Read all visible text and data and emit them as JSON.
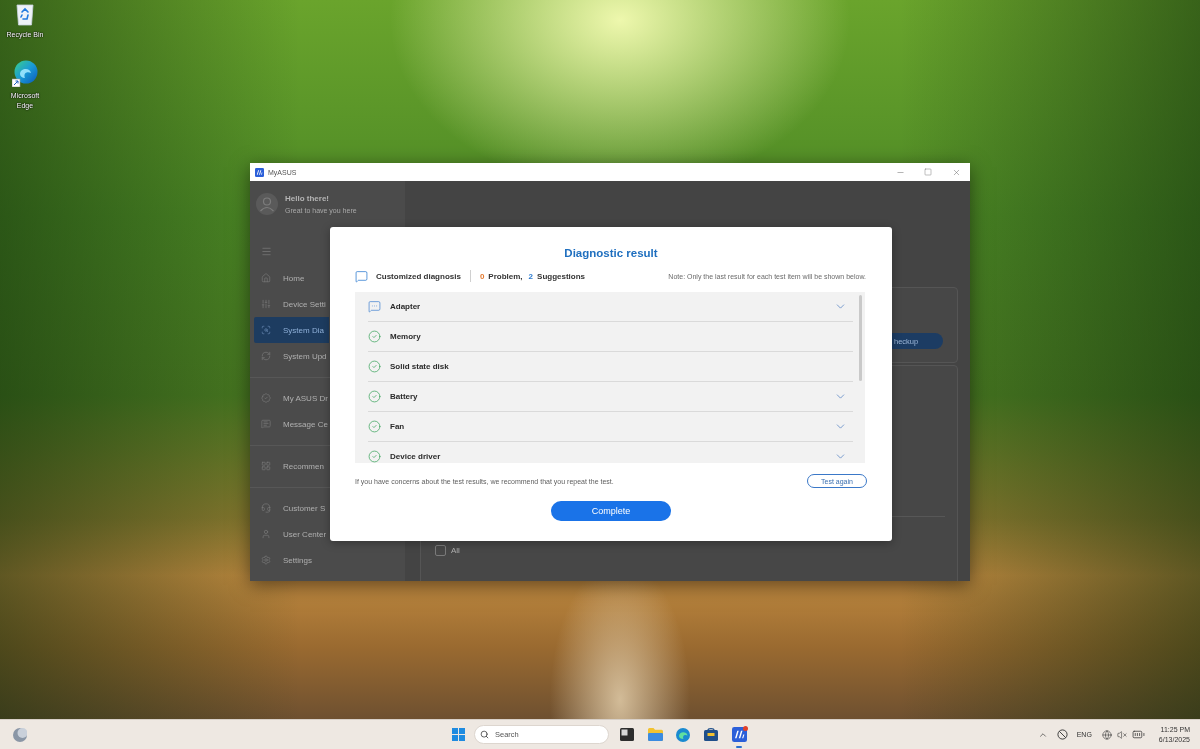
{
  "desktop_icons": [
    {
      "label": "Recycle Bin",
      "kind": "recycle-bin"
    },
    {
      "label": "Microsoft Edge",
      "kind": "edge"
    }
  ],
  "window": {
    "title": "MyASUS",
    "sidebar": {
      "greeting": "Hello there!",
      "subtitle": "Great to have you here",
      "groups": [
        {
          "items": [
            {
              "label": "Home",
              "kind": "home",
              "selected": false
            },
            {
              "label": "Device Setti",
              "kind": "device-settings",
              "selected": false
            },
            {
              "label": "System Dia",
              "kind": "system-diagnosis",
              "selected": true
            },
            {
              "label": "System Upd",
              "kind": "system-update",
              "selected": false
            }
          ]
        },
        {
          "items": [
            {
              "label": "My ASUS Dr",
              "kind": "deals",
              "selected": false
            },
            {
              "label": "Message Ce",
              "kind": "messages",
              "selected": false
            }
          ]
        },
        {
          "items": [
            {
              "label": "Recommen",
              "kind": "recommend",
              "selected": false
            }
          ]
        },
        {
          "items": [
            {
              "label": "Customer S",
              "kind": "support",
              "selected": false
            },
            {
              "label": "User Center",
              "kind": "user",
              "selected": false
            },
            {
              "label": "Settings",
              "kind": "settings",
              "selected": false
            }
          ]
        }
      ]
    },
    "main": {
      "checkup_button": "heckup",
      "select_all": {
        "label": "All",
        "checked": false
      }
    }
  },
  "dialog": {
    "title": "Diagnostic result",
    "scan_type": "Customized diagnosis",
    "problem_count": "0",
    "problem_label": "Problem,",
    "suggestion_count": "2",
    "suggestion_label": "Suggestions",
    "note": "Note: Only the last result for each test item will be shown below.",
    "results": [
      {
        "name": "Adapter",
        "kind": "suggestion",
        "expandable": true
      },
      {
        "name": "Memory",
        "kind": "pass",
        "expandable": false
      },
      {
        "name": "Solid state disk",
        "kind": "pass",
        "expandable": false
      },
      {
        "name": "Battery",
        "kind": "pass",
        "expandable": true
      },
      {
        "name": "Fan",
        "kind": "pass",
        "expandable": true
      },
      {
        "name": "Device driver",
        "kind": "pass",
        "expandable": true
      }
    ],
    "advice": "If you have concerns about the test results, we recommend that you repeat the test.",
    "buttons": [
      {
        "label": "Test again",
        "kind": "outline"
      },
      {
        "label": "Complete",
        "kind": "primary"
      }
    ]
  },
  "taskbar": {
    "search": {
      "placeholder": "Search"
    },
    "apps": [
      {
        "kind": "task-view",
        "running": false,
        "badge": false
      },
      {
        "kind": "files",
        "running": false,
        "badge": false
      },
      {
        "kind": "edge",
        "running": false,
        "badge": false
      },
      {
        "kind": "store",
        "running": false,
        "badge": false
      },
      {
        "kind": "myasus",
        "running": true,
        "badge": true
      }
    ],
    "language": "ENG",
    "time": "11:25 PM",
    "date": "6/13/2025"
  }
}
